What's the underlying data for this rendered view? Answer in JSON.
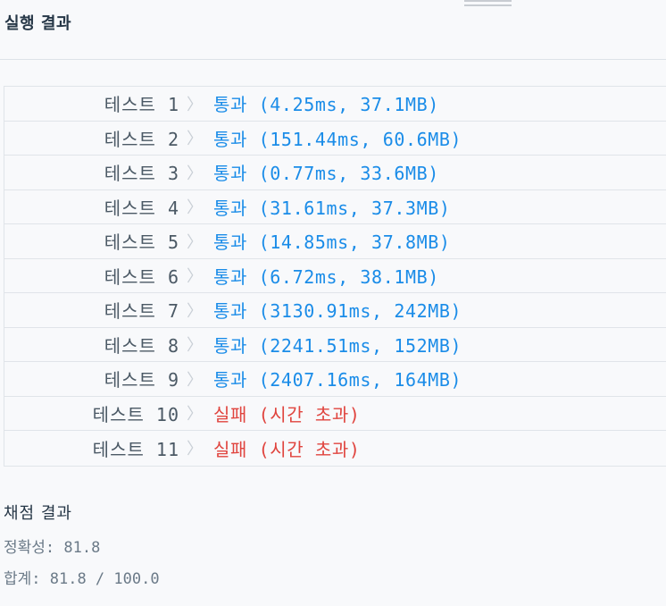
{
  "header": {
    "title": "실행 결과"
  },
  "tests": [
    {
      "label": "테스트 1",
      "status": "pass",
      "result": "통과 (4.25ms, 37.1MB)"
    },
    {
      "label": "테스트 2",
      "status": "pass",
      "result": "통과 (151.44ms, 60.6MB)"
    },
    {
      "label": "테스트 3",
      "status": "pass",
      "result": "통과 (0.77ms, 33.6MB)"
    },
    {
      "label": "테스트 4",
      "status": "pass",
      "result": "통과 (31.61ms, 37.3MB)"
    },
    {
      "label": "테스트 5",
      "status": "pass",
      "result": "통과 (14.85ms, 37.8MB)"
    },
    {
      "label": "테스트 6",
      "status": "pass",
      "result": "통과 (6.72ms, 38.1MB)"
    },
    {
      "label": "테스트 7",
      "status": "pass",
      "result": "통과 (3130.91ms, 242MB)"
    },
    {
      "label": "테스트 8",
      "status": "pass",
      "result": "통과 (2241.51ms, 152MB)"
    },
    {
      "label": "테스트 9",
      "status": "pass",
      "result": "통과 (2407.16ms, 164MB)"
    },
    {
      "label": "테스트 10",
      "status": "fail",
      "result": "실패 (시간 초과)"
    },
    {
      "label": "테스트 11",
      "status": "fail",
      "result": "실패 (시간 초과)"
    }
  ],
  "chevron_icon": "chevron-right-icon",
  "colors": {
    "pass": "#1a8ce8",
    "fail": "#e0443e",
    "label": "#4b5965",
    "muted": "#6b7a88",
    "background": "#f8f9fb"
  },
  "score": {
    "title": "채점 결과",
    "accuracy": "정확성: 81.8",
    "total": "합계: 81.8 / 100.0"
  }
}
